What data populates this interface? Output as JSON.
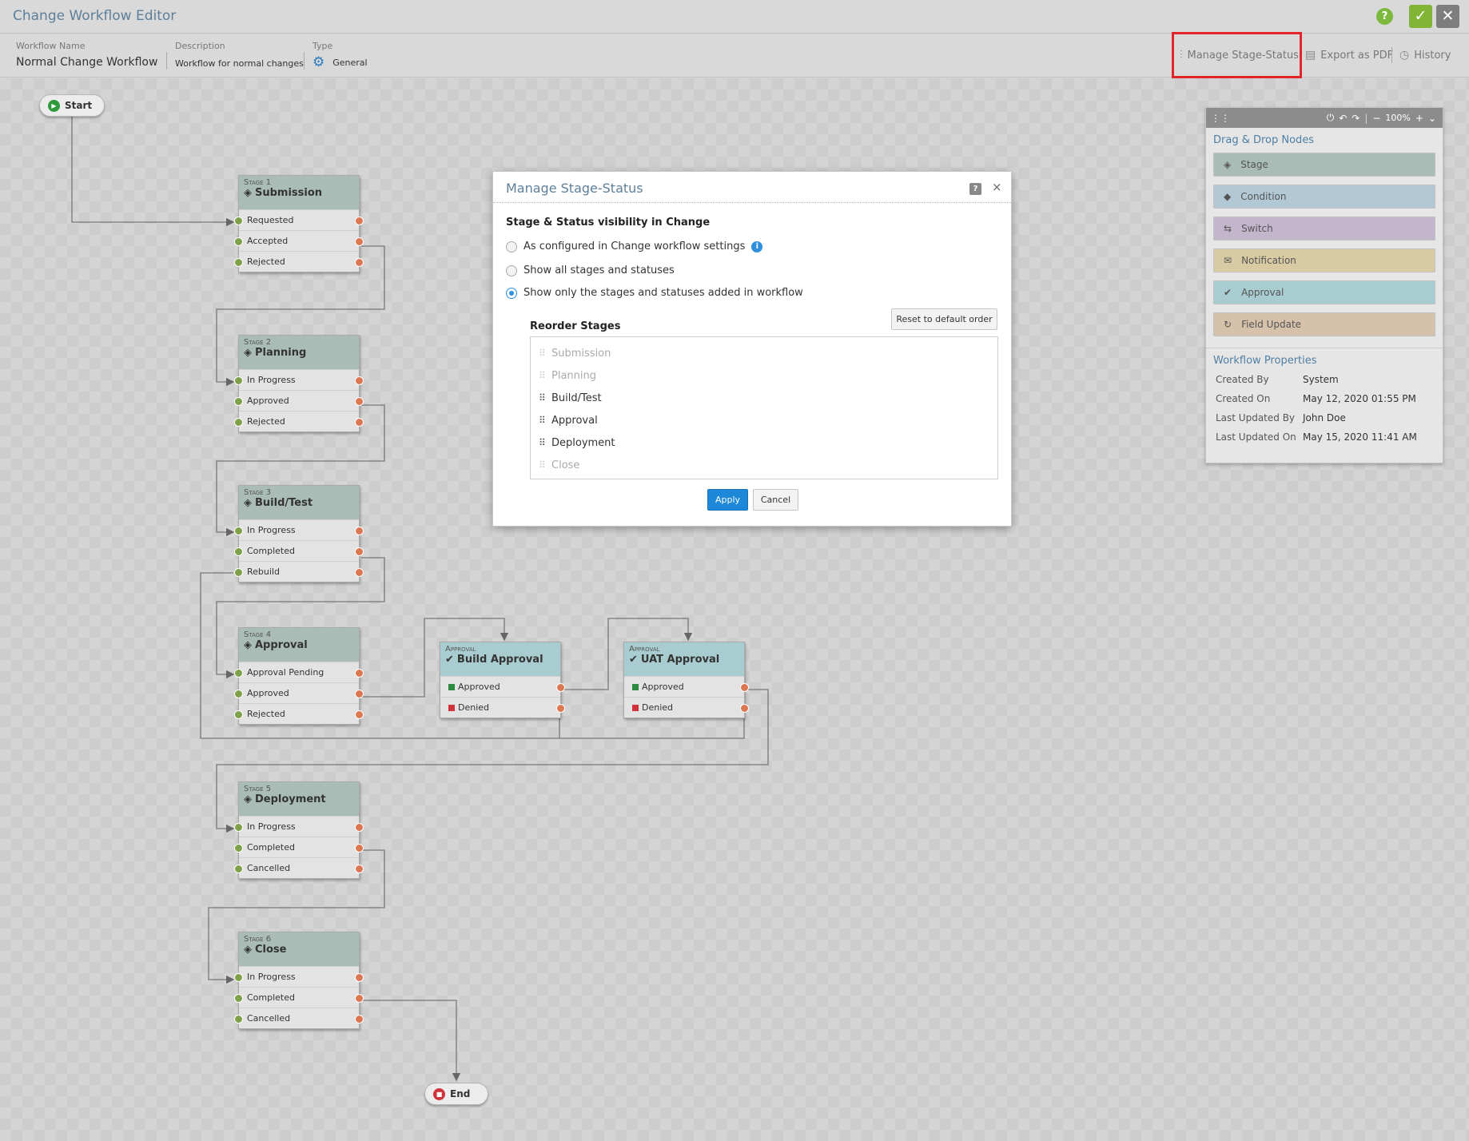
{
  "app": {
    "title": "Change Workflow Editor"
  },
  "header": {
    "workflow_name_label": "Workflow Name",
    "workflow_name": "Normal Change Workflow",
    "description_label": "Description",
    "description": "Workflow for normal changes",
    "type_label": "Type",
    "type": "General",
    "actions": {
      "manage_stage_status": "Manage Stage-Status",
      "export_pdf": "Export as PDF",
      "history": "History"
    }
  },
  "nodes": {
    "start": "Start",
    "end": "End",
    "stages": [
      {
        "kind": "Stage 1",
        "name": "Submission",
        "statuses": [
          "Requested",
          "Accepted",
          "Rejected"
        ]
      },
      {
        "kind": "Stage 2",
        "name": "Planning",
        "statuses": [
          "In Progress",
          "Approved",
          "Rejected"
        ]
      },
      {
        "kind": "Stage 3",
        "name": "Build/Test",
        "statuses": [
          "In Progress",
          "Completed",
          "Rebuild"
        ]
      },
      {
        "kind": "Stage 4",
        "name": "Approval",
        "statuses": [
          "Approval Pending",
          "Approved",
          "Rejected"
        ]
      },
      {
        "kind": "Stage 5",
        "name": "Deployment",
        "statuses": [
          "In Progress",
          "Completed",
          "Cancelled"
        ]
      },
      {
        "kind": "Stage 6",
        "name": "Close",
        "statuses": [
          "In Progress",
          "Completed",
          "Cancelled"
        ]
      }
    ],
    "approvals": [
      {
        "kind": "Approval",
        "name": "Build Approval",
        "outcomes": [
          "Approved",
          "Denied"
        ]
      },
      {
        "kind": "Approval",
        "name": "UAT Approval",
        "outcomes": [
          "Approved",
          "Denied"
        ]
      }
    ]
  },
  "palette": {
    "zoom": "100%",
    "title": "Drag & Drop Nodes",
    "items": [
      {
        "label": "Stage",
        "color": "#a9bcb5"
      },
      {
        "label": "Condition",
        "color": "#b2c8d4"
      },
      {
        "label": "Switch",
        "color": "#c3b5cc"
      },
      {
        "label": "Notification",
        "color": "#d8cba4"
      },
      {
        "label": "Approval",
        "color": "#a9ccd0"
      },
      {
        "label": "Field Update",
        "color": "#d6c2ab"
      }
    ],
    "properties_title": "Workflow Properties",
    "properties": [
      {
        "key": "Created By",
        "value": "System"
      },
      {
        "key": "Created On",
        "value": "May 12, 2020 01:55 PM"
      },
      {
        "key": "Last Updated By",
        "value": "John Doe"
      },
      {
        "key": "Last Updated On",
        "value": "May 15, 2020 11:41 AM"
      }
    ]
  },
  "modal": {
    "title": "Manage Stage-Status",
    "section_title": "Stage & Status visibility in Change",
    "options": [
      {
        "label": "As configured in Change workflow settings",
        "selected": false
      },
      {
        "label": "Show all stages and statuses",
        "selected": false
      },
      {
        "label": "Show only the stages and statuses added in workflow",
        "selected": true
      }
    ],
    "reorder_title": "Reorder Stages",
    "reset_label": "Reset to default order",
    "stages": [
      {
        "name": "Submission",
        "enabled": false
      },
      {
        "name": "Planning",
        "enabled": false
      },
      {
        "name": "Build/Test",
        "enabled": true
      },
      {
        "name": "Approval",
        "enabled": true
      },
      {
        "name": "Deployment",
        "enabled": true
      },
      {
        "name": "Close",
        "enabled": false
      }
    ],
    "apply_label": "Apply",
    "cancel_label": "Cancel"
  }
}
